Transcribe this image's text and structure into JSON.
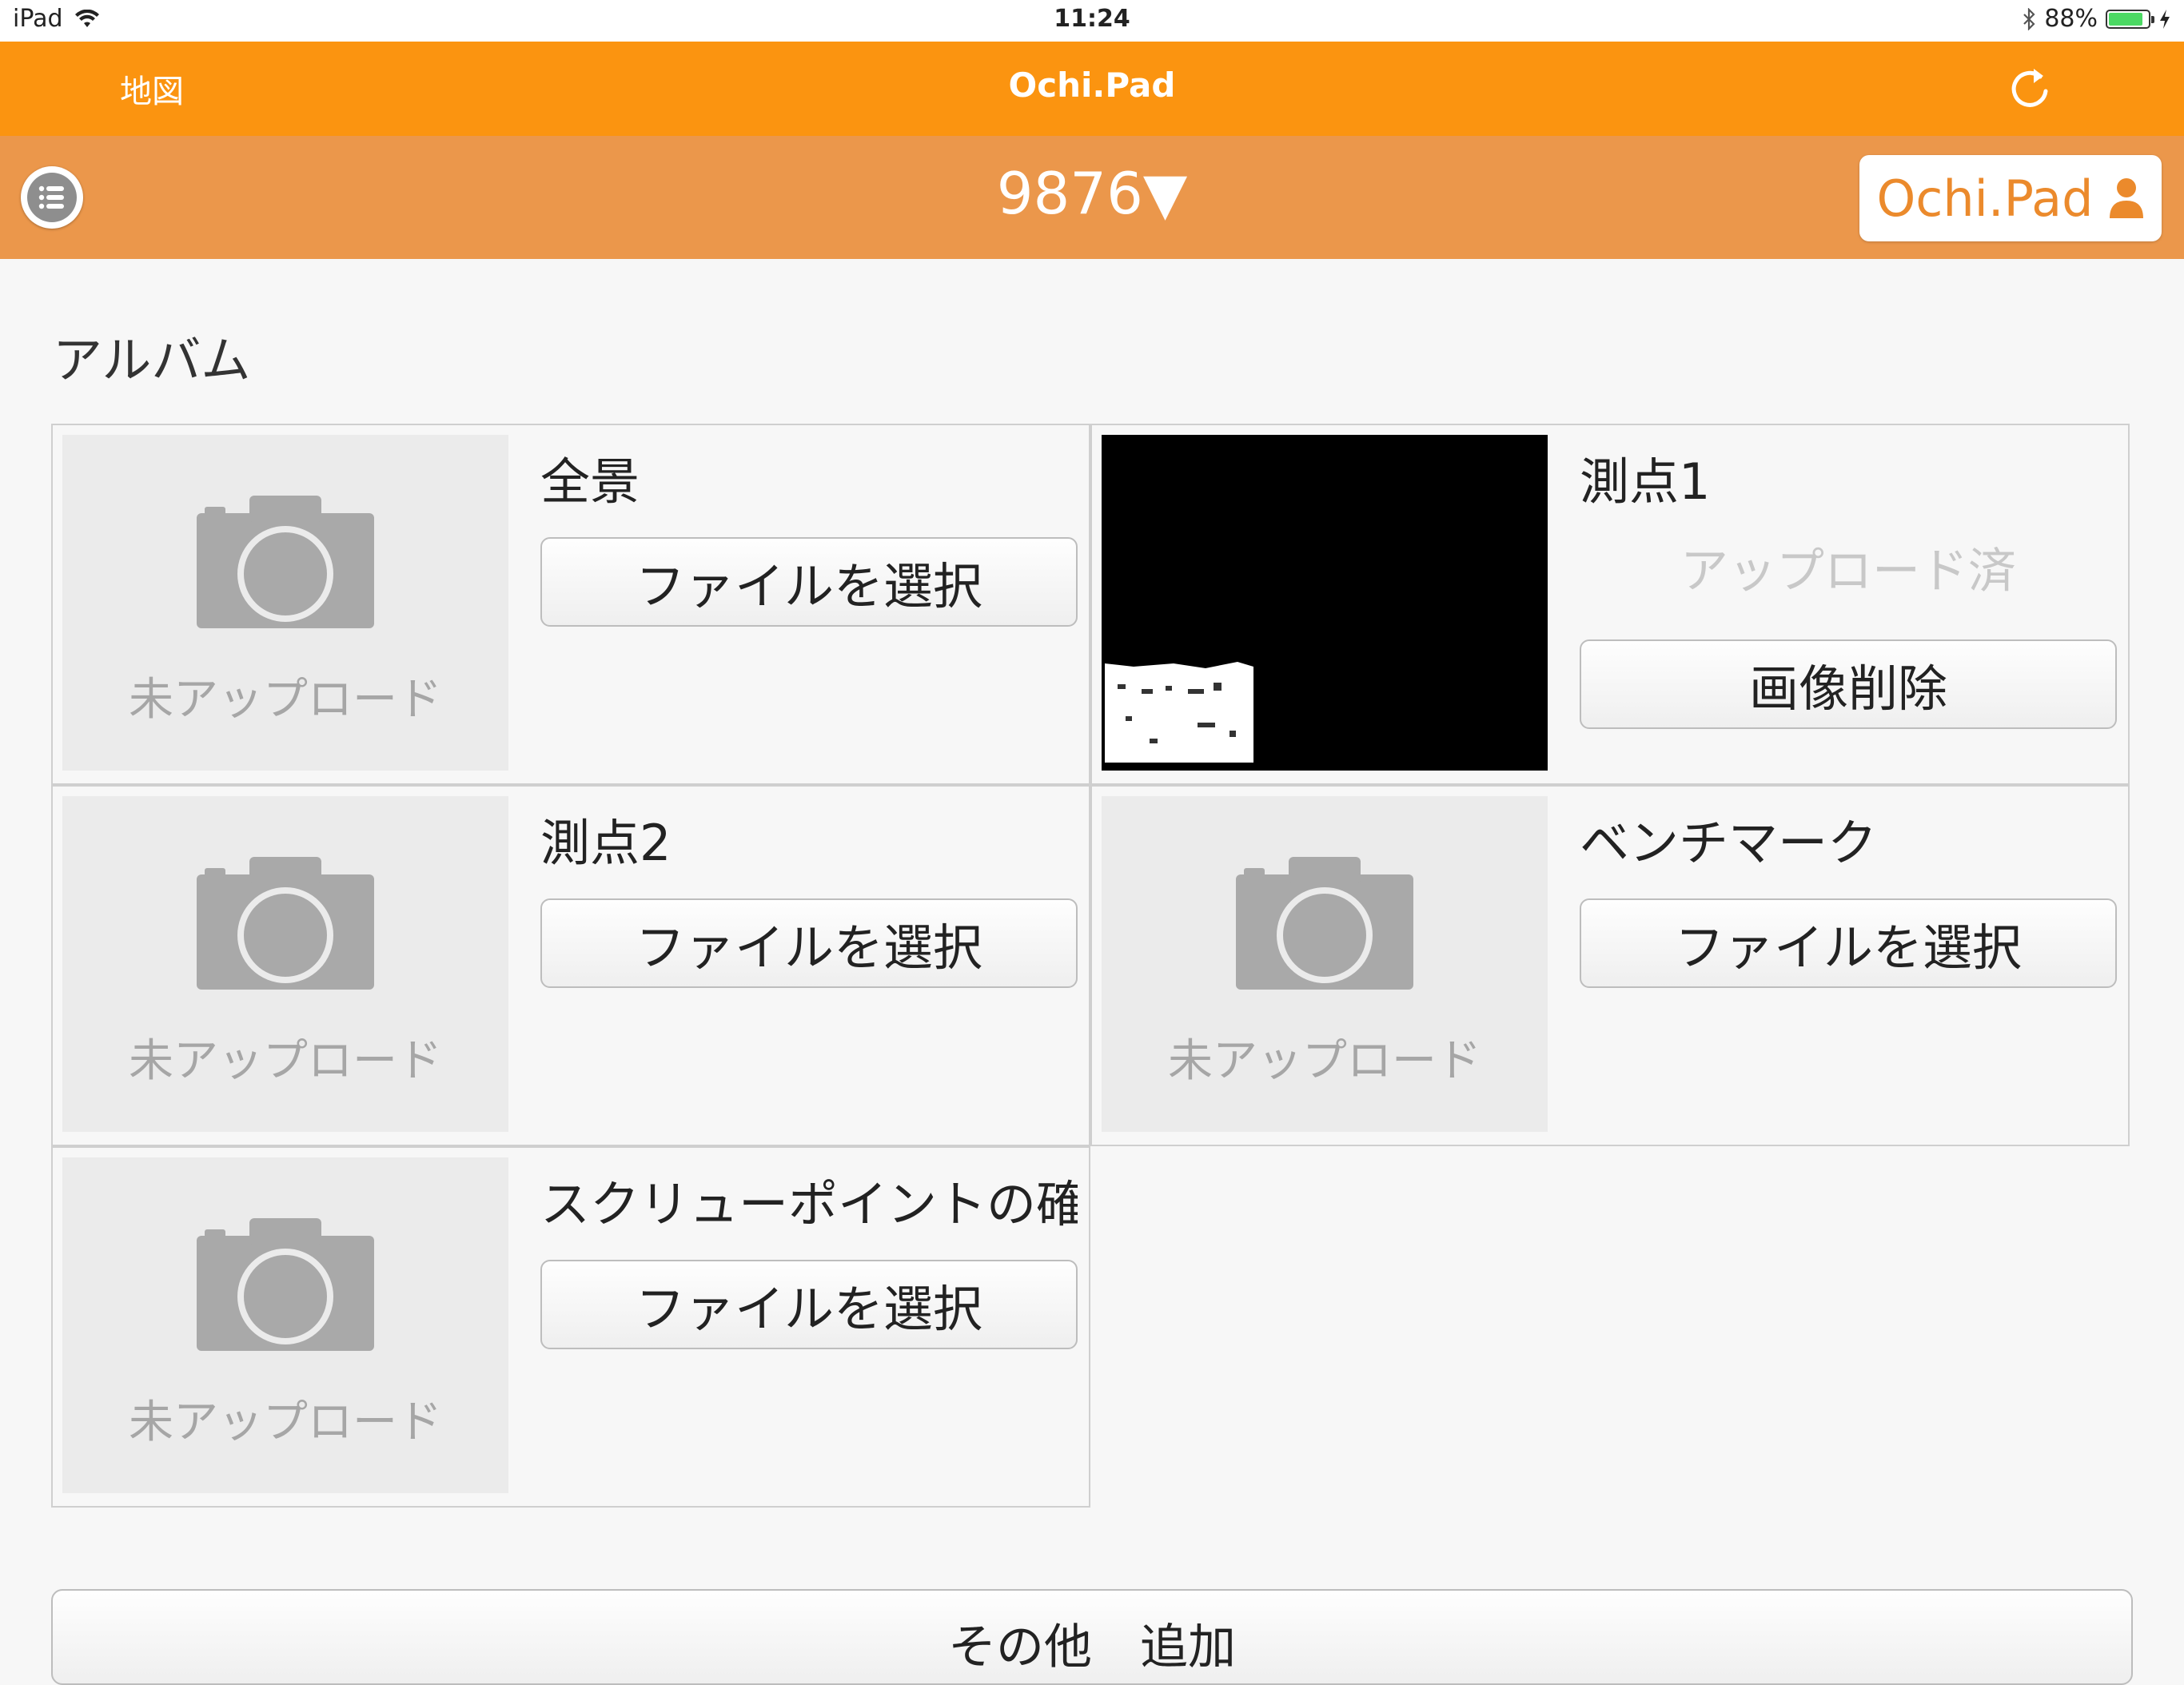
{
  "status_bar": {
    "device": "iPad",
    "time": "11:24",
    "battery_percent": "88%",
    "battery_level": 0.88
  },
  "nav": {
    "left_label": "地図",
    "title": "Ochi.Pad",
    "refresh_icon": "refresh-icon"
  },
  "subnav": {
    "list_icon": "list-icon",
    "selector_value": "9876▼",
    "user_button_label": "Ochi.Pad"
  },
  "album": {
    "title": "アルバム",
    "items": [
      {
        "title": "全景",
        "thumb_label": "未アップロード",
        "button": "ファイルを選択"
      },
      {
        "title": "測点1",
        "status": "アップロード済",
        "button": "画像削除"
      },
      {
        "title": "測点2",
        "thumb_label": "未アップロード",
        "button": "ファイルを選択"
      },
      {
        "title": "ベンチマーク",
        "thumb_label": "未アップロード",
        "button": "ファイルを選択"
      },
      {
        "title": "スクリューポイントの確",
        "thumb_label": "未アップロード",
        "button": "ファイルを選択"
      }
    ]
  },
  "footer": {
    "other_button": "その他　追加"
  }
}
